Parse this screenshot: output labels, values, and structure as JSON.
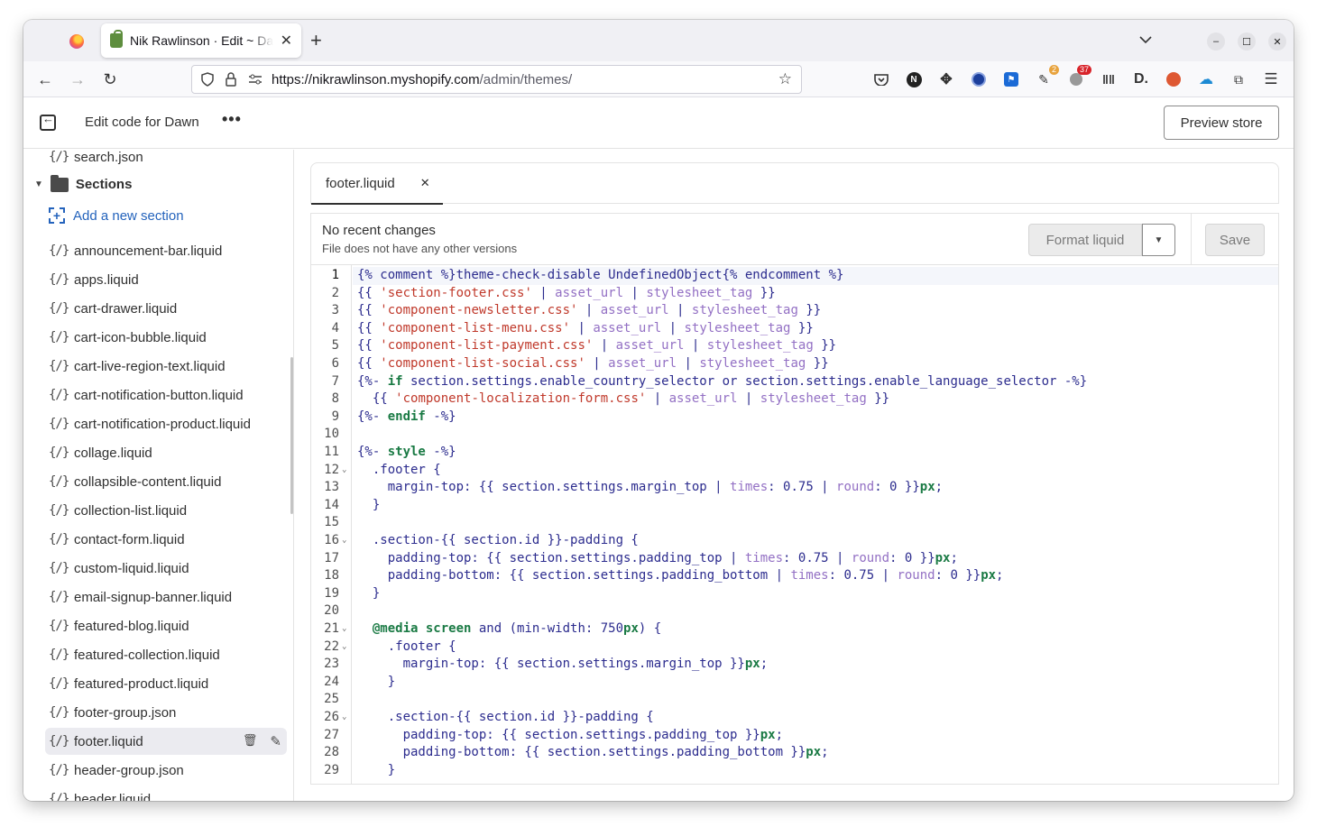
{
  "browser": {
    "tab_title": "Nik Rawlinson · Edit ~ Dawn",
    "url_host": "https://nikrawlinson.myshopify.com",
    "url_path": "/admin/themes/",
    "badges": {
      "ext1": "2",
      "ext2": "37"
    }
  },
  "header": {
    "title": "Edit code for Dawn",
    "more": "•••",
    "preview_label": "Preview store"
  },
  "sidebar": {
    "top_file": "search.json",
    "folder_label": "Sections",
    "add_label": "Add a new section",
    "files": [
      "announcement-bar.liquid",
      "apps.liquid",
      "cart-drawer.liquid",
      "cart-icon-bubble.liquid",
      "cart-live-region-text.liquid",
      "cart-notification-button.liquid",
      "cart-notification-product.liquid",
      "collage.liquid",
      "collapsible-content.liquid",
      "collection-list.liquid",
      "contact-form.liquid",
      "custom-liquid.liquid",
      "email-signup-banner.liquid",
      "featured-blog.liquid",
      "featured-collection.liquid",
      "featured-product.liquid",
      "footer-group.json",
      "footer.liquid",
      "header-group.json",
      "header.liquid"
    ],
    "selected": "footer.liquid"
  },
  "editor": {
    "tab_label": "footer.liquid",
    "status_title": "No recent changes",
    "status_sub": "File does not have any other versions",
    "format_label": "Format liquid",
    "save_label": "Save",
    "lines": [
      "{% comment %}theme-check-disable UndefinedObject{% endcomment %}",
      "{{ 'section-footer.css' | asset_url | stylesheet_tag }}",
      "{{ 'component-newsletter.css' | asset_url | stylesheet_tag }}",
      "{{ 'component-list-menu.css' | asset_url | stylesheet_tag }}",
      "{{ 'component-list-payment.css' | asset_url | stylesheet_tag }}",
      "{{ 'component-list-social.css' | asset_url | stylesheet_tag }}",
      "{%- if section.settings.enable_country_selector or section.settings.enable_language_selector -%}",
      "  {{ 'component-localization-form.css' | asset_url | stylesheet_tag }}",
      "{%- endif -%}",
      "",
      "{%- style -%}",
      "  .footer {",
      "    margin-top: {{ section.settings.margin_top | times: 0.75 | round: 0 }}px;",
      "  }",
      "",
      "  .section-{{ section.id }}-padding {",
      "    padding-top: {{ section.settings.padding_top | times: 0.75 | round: 0 }}px;",
      "    padding-bottom: {{ section.settings.padding_bottom | times: 0.75 | round: 0 }}px;",
      "  }",
      "",
      "  @media screen and (min-width: 750px) {",
      "    .footer {",
      "      margin-top: {{ section.settings.margin_top }}px;",
      "    }",
      "",
      "    .section-{{ section.id }}-padding {",
      "      padding-top: {{ section.settings.padding_top }}px;",
      "      padding-bottom: {{ section.settings.padding_bottom }}px;",
      "    }"
    ],
    "fold_lines": [
      12,
      16,
      21,
      22,
      26
    ]
  },
  "colors": {
    "link": "#2463bc",
    "keyword": "#1a7a44",
    "string": "#c0392b",
    "filter": "#9370c4",
    "tag": "#2c2c8e"
  }
}
